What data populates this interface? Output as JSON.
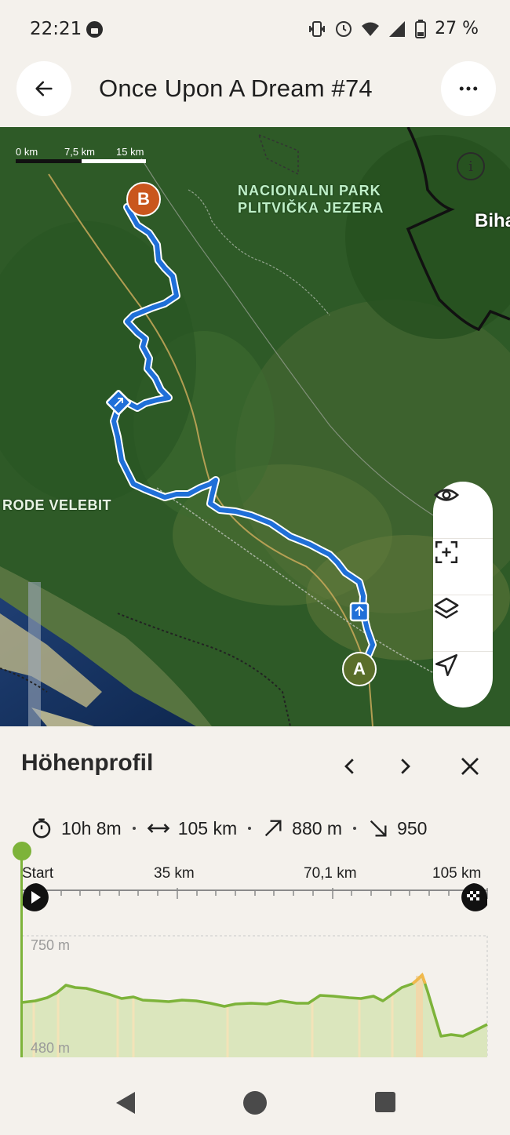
{
  "status_bar": {
    "time": "22:21",
    "battery": "27 %"
  },
  "header": {
    "title": "Once Upon A Dream #74",
    "back_icon": "arrow-left-icon",
    "more_icon": "more-horizontal-icon"
  },
  "map": {
    "scale": {
      "zero": "0 km",
      "mid": "7,5 km",
      "end": "15 km"
    },
    "labels": {
      "park": "NACIONALNI PARK\nPLITVIČKA JEZERA",
      "velebit": "RODE VELEBIT",
      "town": "Biha"
    },
    "marker_start": "A",
    "marker_end": "B",
    "colors": {
      "route": "#1f6fd8",
      "start_marker": "#5a6e2a",
      "end_marker": "#c9561d"
    },
    "tools": [
      "eye-icon",
      "focus-plus-icon",
      "layers-icon",
      "navigation-arrow-icon"
    ]
  },
  "profile": {
    "title": "Höhenprofil",
    "stats": {
      "duration": "10h 8m",
      "distance": "105 km",
      "ascent": "880 m",
      "descent": "950"
    },
    "axis": {
      "start": "Start",
      "t1": "35 km",
      "t2": "70,1 km",
      "end": "105 km"
    },
    "elevation": {
      "top": "750 m",
      "bottom": "480 m"
    },
    "colors": {
      "line": "#7db33a",
      "fill": "#dbe6bd",
      "highlight": "#f2b84b"
    }
  }
}
